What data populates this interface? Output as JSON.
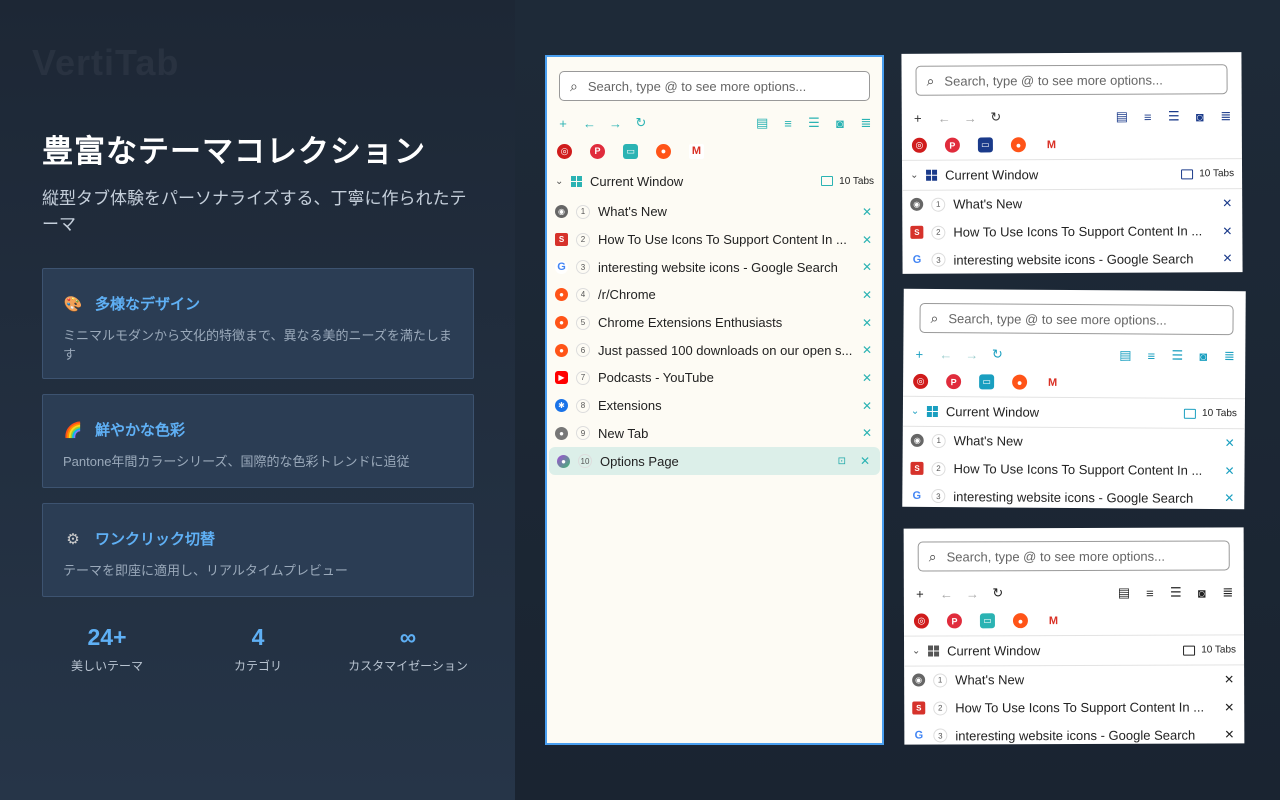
{
  "brand": "VertiTab",
  "headline": "豊富なテーマコレクション",
  "subtitle": "縦型タブ体験をパーソナライズする、丁寧に作られたテーマ",
  "features": [
    {
      "icon": "palette-icon",
      "glyph": "🎨",
      "title": "多様なデザイン",
      "desc": "ミニマルモダンから文化的特徴まで、異なる美的ニーズを満たします"
    },
    {
      "icon": "rainbow-icon",
      "glyph": "🌈",
      "title": "鮮やかな色彩",
      "desc": "Pantone年間カラーシリーズ、国際的な色彩トレンドに追従"
    },
    {
      "icon": "gear-icon",
      "glyph": "⚙",
      "title": "ワンクリック切替",
      "desc": "テーマを即座に適用し、リアルタイムプレビュー"
    }
  ],
  "stats": [
    {
      "value": "24+",
      "label": "美しいテーマ"
    },
    {
      "value": "4",
      "label": "カテゴリ"
    },
    {
      "value": "∞",
      "label": "カスタマイゼーション"
    }
  ],
  "sidebar": {
    "search_placeholder": "Search, type @ to see more options...",
    "window_title": "Current Window",
    "tab_count": "10 Tabs",
    "accent_color": "#2bb3b3",
    "tabs": [
      {
        "n": "1",
        "title": "What's New",
        "favicon": "chrome-icon"
      },
      {
        "n": "2",
        "title": "How To Use Icons To Support Content In ...",
        "favicon": "content-site-icon"
      },
      {
        "n": "3",
        "title": "interesting website icons - Google Search",
        "favicon": "google-icon"
      },
      {
        "n": "4",
        "title": "/r/Chrome",
        "favicon": "reddit-icon"
      },
      {
        "n": "5",
        "title": "Chrome Extensions Enthusiasts",
        "favicon": "reddit-icon"
      },
      {
        "n": "6",
        "title": "Just passed 100 downloads on our open s...",
        "favicon": "reddit-icon"
      },
      {
        "n": "7",
        "title": "Podcasts - YouTube",
        "favicon": "youtube-icon"
      },
      {
        "n": "8",
        "title": "Extensions",
        "favicon": "puzzle-icon"
      },
      {
        "n": "9",
        "title": "New Tab",
        "favicon": "newtab-icon"
      },
      {
        "n": "10",
        "title": "Options Page",
        "favicon": "options-icon"
      }
    ],
    "bookmarks": [
      "target-icon",
      "pinterest-icon",
      "bilibili-icon",
      "reddit-icon",
      "gmail-icon"
    ]
  },
  "previews": [
    {
      "accent": "#1a3a8a"
    },
    {
      "accent": "#1a9fc0"
    },
    {
      "accent": "#222222"
    }
  ]
}
